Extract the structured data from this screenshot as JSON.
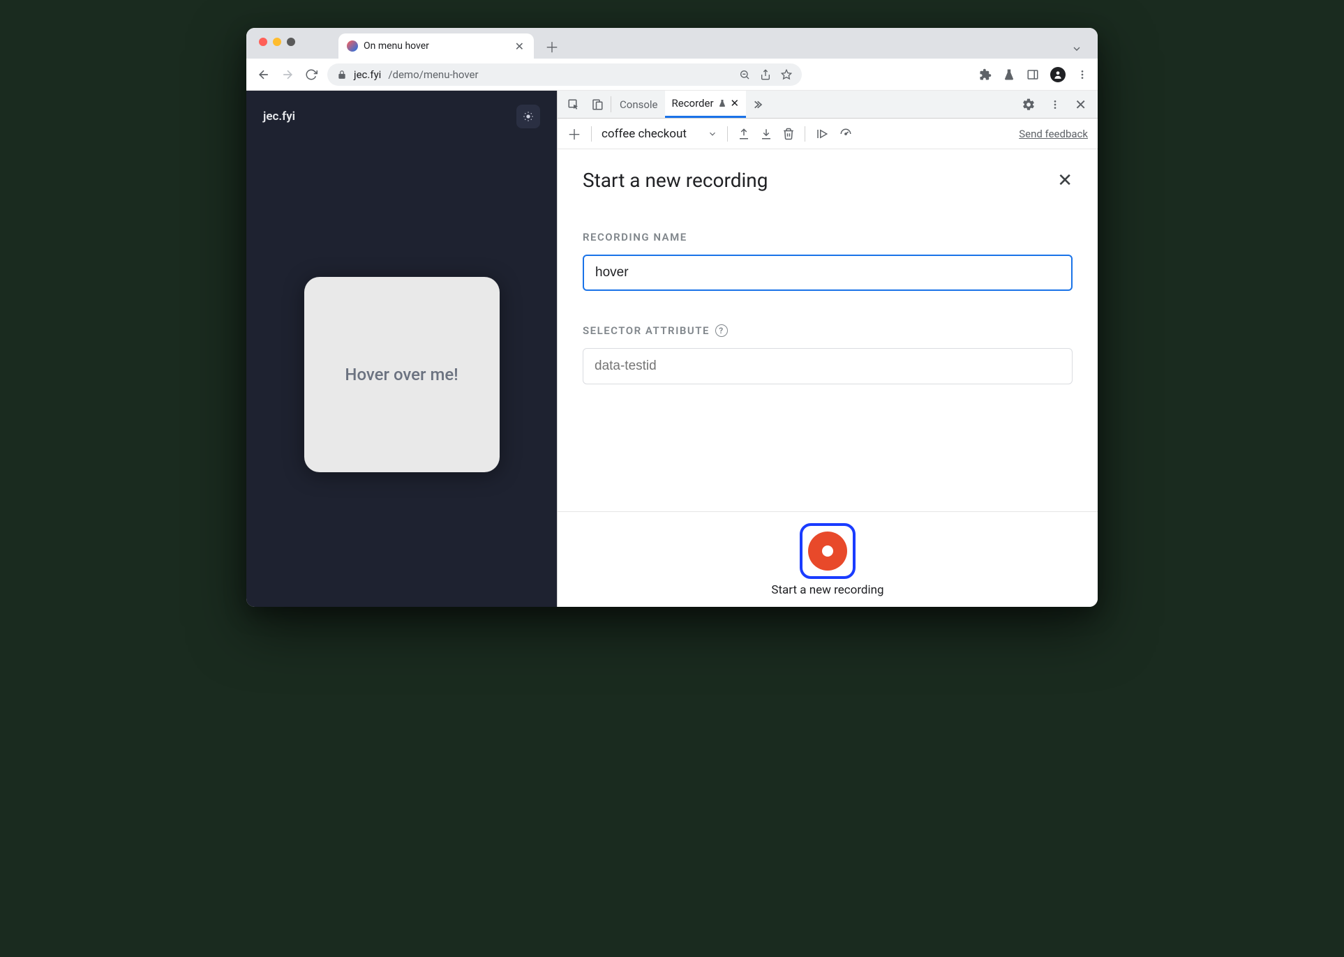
{
  "browser": {
    "tab_title": "On menu hover",
    "url_host": "jec.fyi",
    "url_path": "/demo/menu-hover"
  },
  "page": {
    "site_title": "jec.fyi",
    "card_text": "Hover over me!"
  },
  "devtools": {
    "tabs": {
      "console": "Console",
      "recorder": "Recorder"
    },
    "toolbar": {
      "recording_select": "coffee checkout",
      "feedback": "Send feedback"
    },
    "panel": {
      "title": "Start a new recording",
      "name_label": "RECORDING NAME",
      "name_value": "hover",
      "selector_label": "SELECTOR ATTRIBUTE",
      "selector_placeholder": "data-testid",
      "record_button_label": "Start a new recording"
    }
  }
}
